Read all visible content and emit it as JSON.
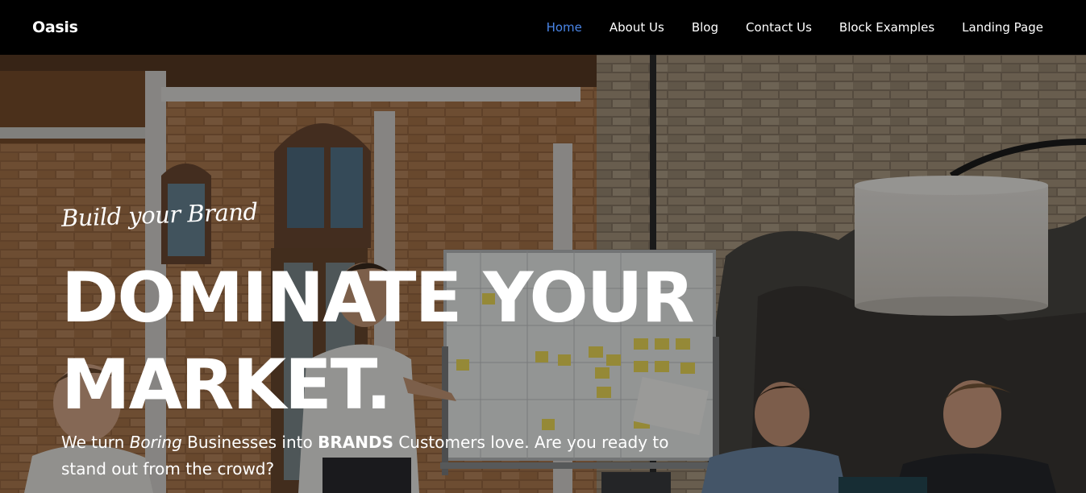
{
  "nav": {
    "brand": "Oasis",
    "links": [
      {
        "label": "Home",
        "active": true
      },
      {
        "label": "About Us",
        "active": false
      },
      {
        "label": "Blog",
        "active": false
      },
      {
        "label": "Contact Us",
        "active": false
      },
      {
        "label": "Block Examples",
        "active": false
      },
      {
        "label": "Landing Page",
        "active": false
      }
    ],
    "active_color": "#4a86e8"
  },
  "hero": {
    "eyebrow": "Build your Brand",
    "headline_line1": "DOMINATE YOUR",
    "headline_line2": "MARKET.",
    "subtext": {
      "part1": "We turn ",
      "italic": "Boring",
      "part2": " Businesses into ",
      "bold": "BRANDS",
      "part3": " Customers love. Are you ready to stand out from the crowd?"
    }
  }
}
